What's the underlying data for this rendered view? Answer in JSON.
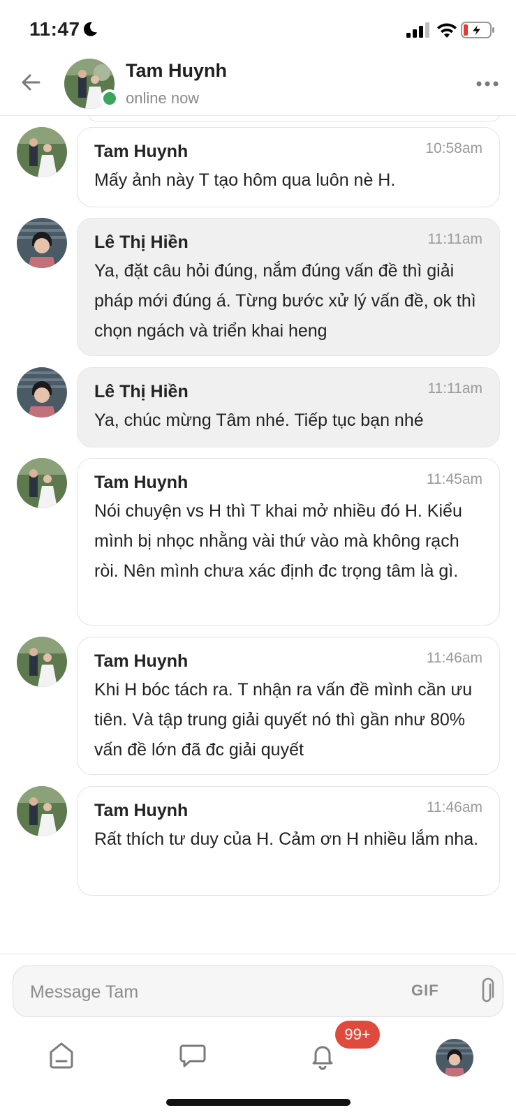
{
  "status_bar": {
    "time": "11:47",
    "battery_state": "low-charging"
  },
  "header": {
    "name": "Tam Huynh",
    "status": "online now",
    "online_color": "#3aa55c"
  },
  "messages": [
    {
      "sender": "Tam Huynh",
      "time": "10:58am",
      "text": "Mấy ảnh này T tạo hôm qua luôn nè H.",
      "kind": "tam"
    },
    {
      "sender": "Lê Thị Hiền",
      "time": "11:11am",
      "text": "Ya, đặt câu hỏi đúng, nắm đúng vấn đề thì giải pháp mới đúng á. Từng bước xử lý vấn đề, ok thì chọn ngách và triển khai heng",
      "kind": "hien"
    },
    {
      "sender": "Lê Thị Hiền",
      "time": "11:11am",
      "text": "Ya, chúc mừng Tâm nhé. Tiếp tục bạn nhé",
      "kind": "hien"
    },
    {
      "sender": "Tam Huynh",
      "time": "11:45am",
      "text": "Nói chuyện vs H thì T khai mở nhiều đó H. Kiểu mình bị nhọc nhằng vài thứ vào mà không rạch ròi. Nên mình chưa xác định đc trọng tâm là gì.",
      "kind": "tam"
    },
    {
      "sender": "Tam Huynh",
      "time": "11:46am",
      "text": "Khi H bóc tách ra. T nhận ra vấn đề mình cần ưu tiên. Và tập trung giải quyết nó thì gần như 80% vấn đề lớn đã đc giải quyết",
      "kind": "tam"
    },
    {
      "sender": "Tam Huynh",
      "time": "11:46am",
      "text": "Rất thích tư duy của H. Cảm ơn H nhiều lắm nha.",
      "kind": "tam"
    }
  ],
  "composer": {
    "placeholder": "Message Tam",
    "gif_label": "GIF"
  },
  "bottom_nav": {
    "notification_badge": "99+"
  },
  "colors": {
    "badge": "#e04a3c",
    "accent_text": "#1f1f1f"
  }
}
